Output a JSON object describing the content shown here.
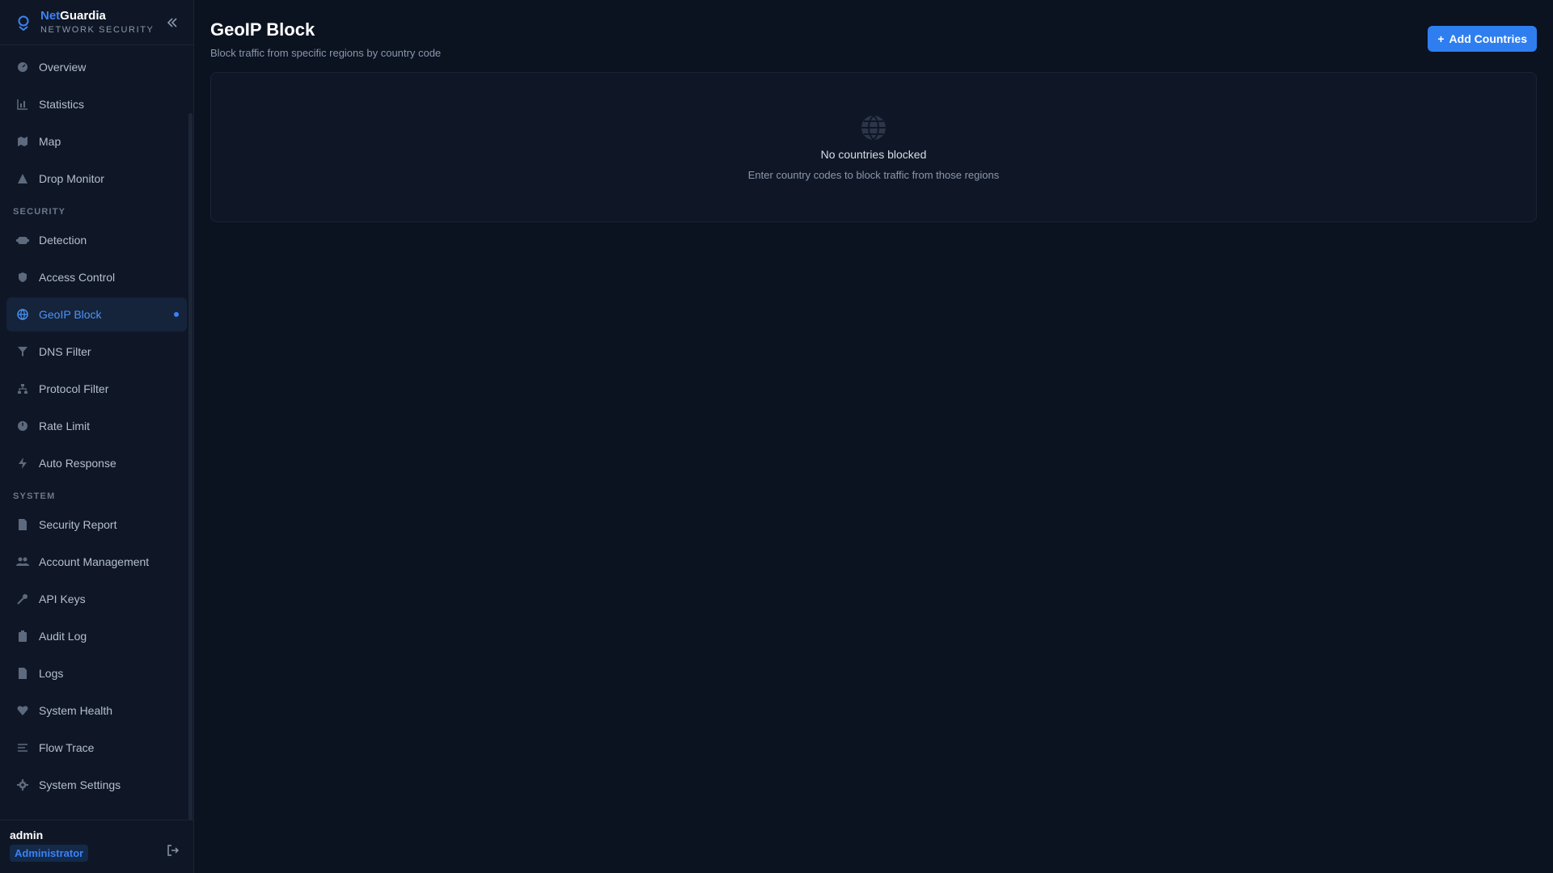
{
  "brand": {
    "name_accent": "Net",
    "name_rest": "Guardia",
    "subtitle": "NETWORK SECURITY"
  },
  "nav": {
    "items_top": [
      {
        "label": "Overview",
        "icon": "gauge-icon"
      },
      {
        "label": "Statistics",
        "icon": "bar-chart-icon"
      },
      {
        "label": "Map",
        "icon": "map-icon"
      },
      {
        "label": "Drop Monitor",
        "icon": "warning-triangle-icon"
      }
    ],
    "section_security": "SECURITY",
    "items_security": [
      {
        "label": "Detection",
        "icon": "robot-icon"
      },
      {
        "label": "Access Control",
        "icon": "shield-icon"
      },
      {
        "label": "GeoIP Block",
        "icon": "globe-icon",
        "active": true
      },
      {
        "label": "DNS Filter",
        "icon": "filter-icon"
      },
      {
        "label": "Protocol Filter",
        "icon": "network-icon"
      },
      {
        "label": "Rate Limit",
        "icon": "speedometer-icon"
      },
      {
        "label": "Auto Response",
        "icon": "bolt-icon"
      }
    ],
    "section_system": "SYSTEM",
    "items_system": [
      {
        "label": "Security Report",
        "icon": "document-icon"
      },
      {
        "label": "Account Management",
        "icon": "users-icon"
      },
      {
        "label": "API Keys",
        "icon": "key-icon"
      },
      {
        "label": "Audit Log",
        "icon": "clipboard-icon"
      },
      {
        "label": "Logs",
        "icon": "file-icon"
      },
      {
        "label": "System Health",
        "icon": "heart-pulse-icon"
      },
      {
        "label": "Flow Trace",
        "icon": "lines-icon"
      },
      {
        "label": "System Settings",
        "icon": "gear-icon"
      }
    ]
  },
  "user": {
    "name": "admin",
    "role": "Administrator"
  },
  "page": {
    "title": "GeoIP Block",
    "subtitle": "Block traffic from specific regions by country code",
    "add_button": "Add Countries"
  },
  "empty": {
    "title": "No countries blocked",
    "description": "Enter country codes to block traffic from those regions"
  },
  "colors": {
    "accent": "#3b82f6",
    "background": "#0b1220",
    "sidebar": "#0f1726"
  }
}
